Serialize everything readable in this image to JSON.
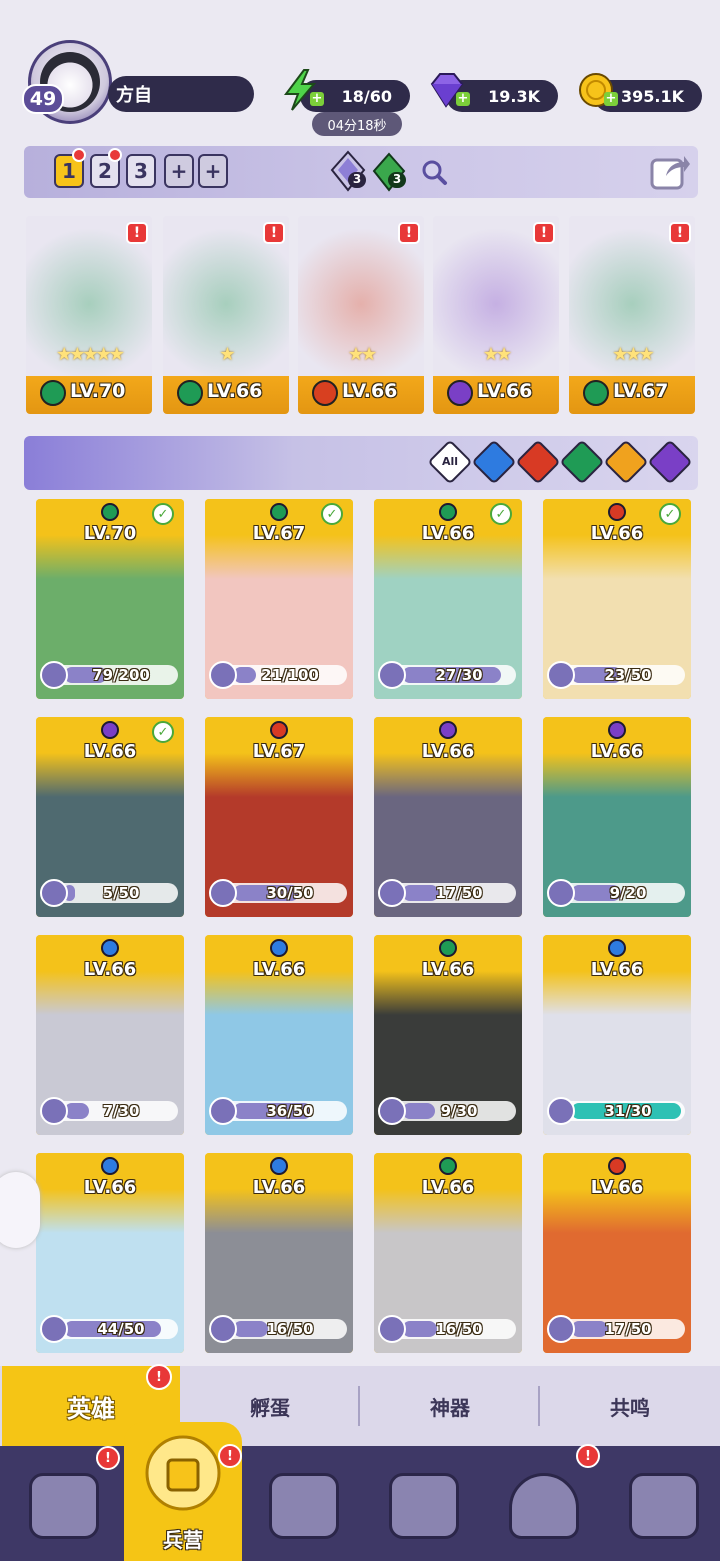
{
  "player": {
    "level": "49",
    "name": "方自"
  },
  "resources": {
    "energy": {
      "value": "18/60",
      "timer": "04分18秒",
      "icon": "lightning-icon"
    },
    "gems": {
      "value": "19.3K",
      "icon": "diamond-icon"
    },
    "gold": {
      "value": "395.1K",
      "icon": "coin-icon"
    }
  },
  "team_bar": {
    "slots": [
      "1",
      "2",
      "3",
      "+",
      "+"
    ],
    "active_slot": "1",
    "purple_count": "3",
    "green_count": "3"
  },
  "lineup": [
    {
      "level": "LV.70",
      "stars": "★★★★★",
      "element": "wind",
      "color": "#1f9b55"
    },
    {
      "level": "LV.66",
      "stars": "★",
      "element": "wind",
      "color": "#1f9b55"
    },
    {
      "level": "LV.66",
      "stars": "★★",
      "element": "fire",
      "color": "#d84020"
    },
    {
      "level": "LV.66",
      "stars": "★★",
      "element": "dark",
      "color": "#7a3fc6"
    },
    {
      "level": "LV.67",
      "stars": "★★★",
      "element": "wind",
      "color": "#1f9b55"
    }
  ],
  "filters": {
    "all_label": "All",
    "elements": [
      {
        "name": "water",
        "color": "#2e7be0"
      },
      {
        "name": "fire",
        "color": "#d83a24"
      },
      {
        "name": "wind",
        "color": "#1f9b55"
      },
      {
        "name": "light",
        "color": "#f0a21e"
      },
      {
        "name": "dark",
        "color": "#7a3fc6"
      }
    ]
  },
  "heroes": [
    {
      "level": "LV.70",
      "shards": "79/200",
      "progress": 0.395,
      "element": "wind",
      "color": "#1f9b55",
      "selected": true,
      "art": "#6cae6a"
    },
    {
      "level": "LV.67",
      "shards": "21/100",
      "progress": 0.21,
      "element": "wind",
      "color": "#1f9b55",
      "selected": true,
      "art": "#f2c6c0"
    },
    {
      "level": "LV.66",
      "shards": "27/30",
      "progress": 0.9,
      "element": "wind",
      "color": "#1f9b55",
      "selected": true,
      "art": "#9fd2c2"
    },
    {
      "level": "LV.66",
      "shards": "23/50",
      "progress": 0.46,
      "element": "fire",
      "color": "#d83a24",
      "selected": true,
      "art": "#f2dfb0"
    },
    {
      "level": "LV.66",
      "shards": "5/50",
      "progress": 0.1,
      "element": "dark",
      "color": "#7a3fc6",
      "selected": true,
      "art": "#4f6a70"
    },
    {
      "level": "LV.67",
      "shards": "30/50",
      "progress": 0.6,
      "element": "fire",
      "color": "#d83a24",
      "selected": false,
      "art": "#b43a2a"
    },
    {
      "level": "LV.66",
      "shards": "17/50",
      "progress": 0.34,
      "element": "dark",
      "color": "#7a3fc6",
      "selected": false,
      "art": "#6a6680"
    },
    {
      "level": "LV.66",
      "shards": "9/20",
      "progress": 0.45,
      "element": "dark",
      "color": "#7a3fc6",
      "selected": false,
      "art": "#4d9a8a"
    },
    {
      "level": "LV.66",
      "shards": "7/30",
      "progress": 0.23,
      "element": "water",
      "color": "#2e7be0",
      "selected": false,
      "art": "#c9c9d4"
    },
    {
      "level": "LV.66",
      "shards": "36/50",
      "progress": 0.72,
      "element": "water",
      "color": "#2e7be0",
      "selected": false,
      "art": "#8fc8e6"
    },
    {
      "level": "LV.66",
      "shards": "9/30",
      "progress": 0.3,
      "element": "wind",
      "color": "#1f9b55",
      "selected": false,
      "art": "#3a3c3a"
    },
    {
      "level": "LV.66",
      "shards": "31/30",
      "progress": 1.0,
      "element": "water",
      "color": "#2e7be0",
      "selected": false,
      "art": "#dfe0ea"
    },
    {
      "level": "LV.66",
      "shards": "44/50",
      "progress": 0.88,
      "element": "water",
      "color": "#2e7be0",
      "selected": false,
      "art": "#bfe0f0"
    },
    {
      "level": "LV.66",
      "shards": "16/50",
      "progress": 0.32,
      "element": "water",
      "color": "#2e7be0",
      "selected": false,
      "art": "#8c8e96"
    },
    {
      "level": "LV.66",
      "shards": "16/50",
      "progress": 0.32,
      "element": "wind",
      "color": "#1f9b55",
      "selected": false,
      "art": "#c8c6c8"
    },
    {
      "level": "LV.66",
      "shards": "17/50",
      "progress": 0.34,
      "element": "fire",
      "color": "#d83a24",
      "selected": false,
      "art": "#e06a30"
    }
  ],
  "sub_tabs": [
    "英雄",
    "孵蛋",
    "神器",
    "共鸣"
  ],
  "bottom_nav": {
    "items": [
      "cards-icon",
      "barracks-icon",
      "book-icon",
      "shop-icon",
      "mushroom-icon",
      "guild-icon"
    ],
    "active_label": "兵营"
  },
  "colors": {
    "accent": "#f5c515",
    "nav": "#3e3866",
    "alert": "#e83838"
  }
}
